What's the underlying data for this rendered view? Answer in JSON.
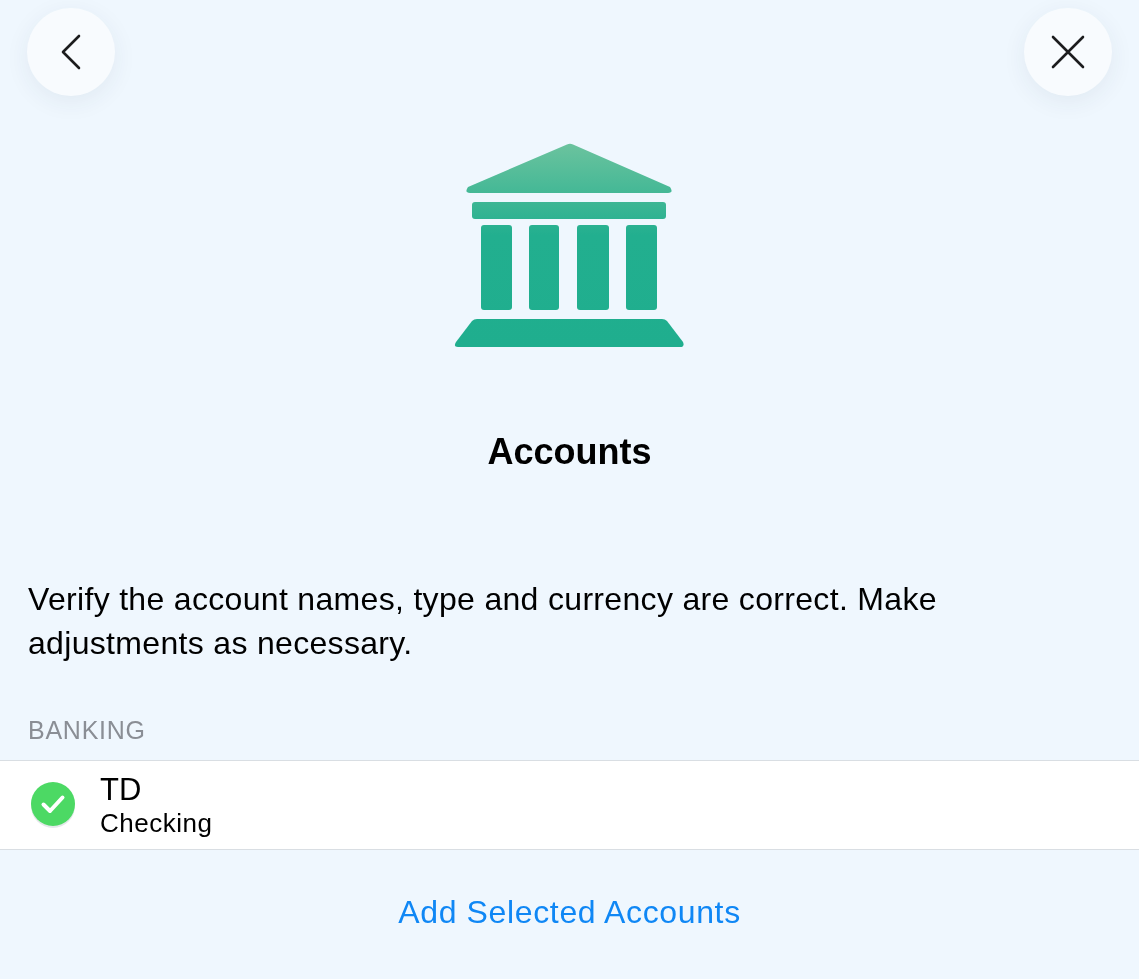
{
  "title": "Accounts",
  "description": "Verify the account names, type and currency are correct. Make adjustments as necessary.",
  "sections": [
    {
      "label": "BANKING",
      "accounts": [
        {
          "name": "TD",
          "type": "Checking",
          "checked": true
        }
      ]
    }
  ],
  "action": "Add Selected Accounts"
}
